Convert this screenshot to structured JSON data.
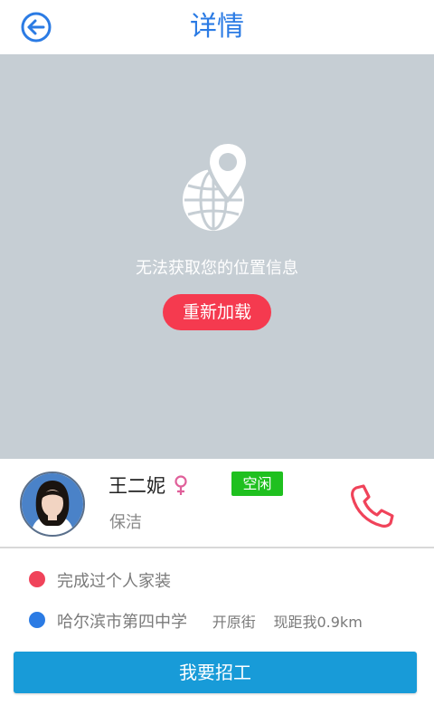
{
  "header": {
    "title": "详情",
    "back_icon": "arrow-left-circle-icon"
  },
  "map": {
    "icon": "globe-location-pin-icon",
    "message": "无法获取您的位置信息",
    "reload_label": "重新加载"
  },
  "worker": {
    "name": "王二妮",
    "gender_icon": "female-symbol-icon",
    "status": "空闲",
    "job": "保洁",
    "phone_icon": "phone-icon"
  },
  "info": {
    "experience": "完成过个人家装",
    "address": "哈尔滨市第四中学",
    "street": "开原街",
    "distance": "现距我0.9km"
  },
  "action": {
    "hire_label": "我要招工"
  },
  "colors": {
    "primary_blue": "#2b7be4",
    "map_bg": "#c6ced4",
    "reload_red": "#f53a4f",
    "status_green": "#1fc01f",
    "phone_red": "#f0435a",
    "hire_blue": "#189bd8",
    "dot_red": "#f0435a",
    "dot_blue": "#2b7be4"
  }
}
